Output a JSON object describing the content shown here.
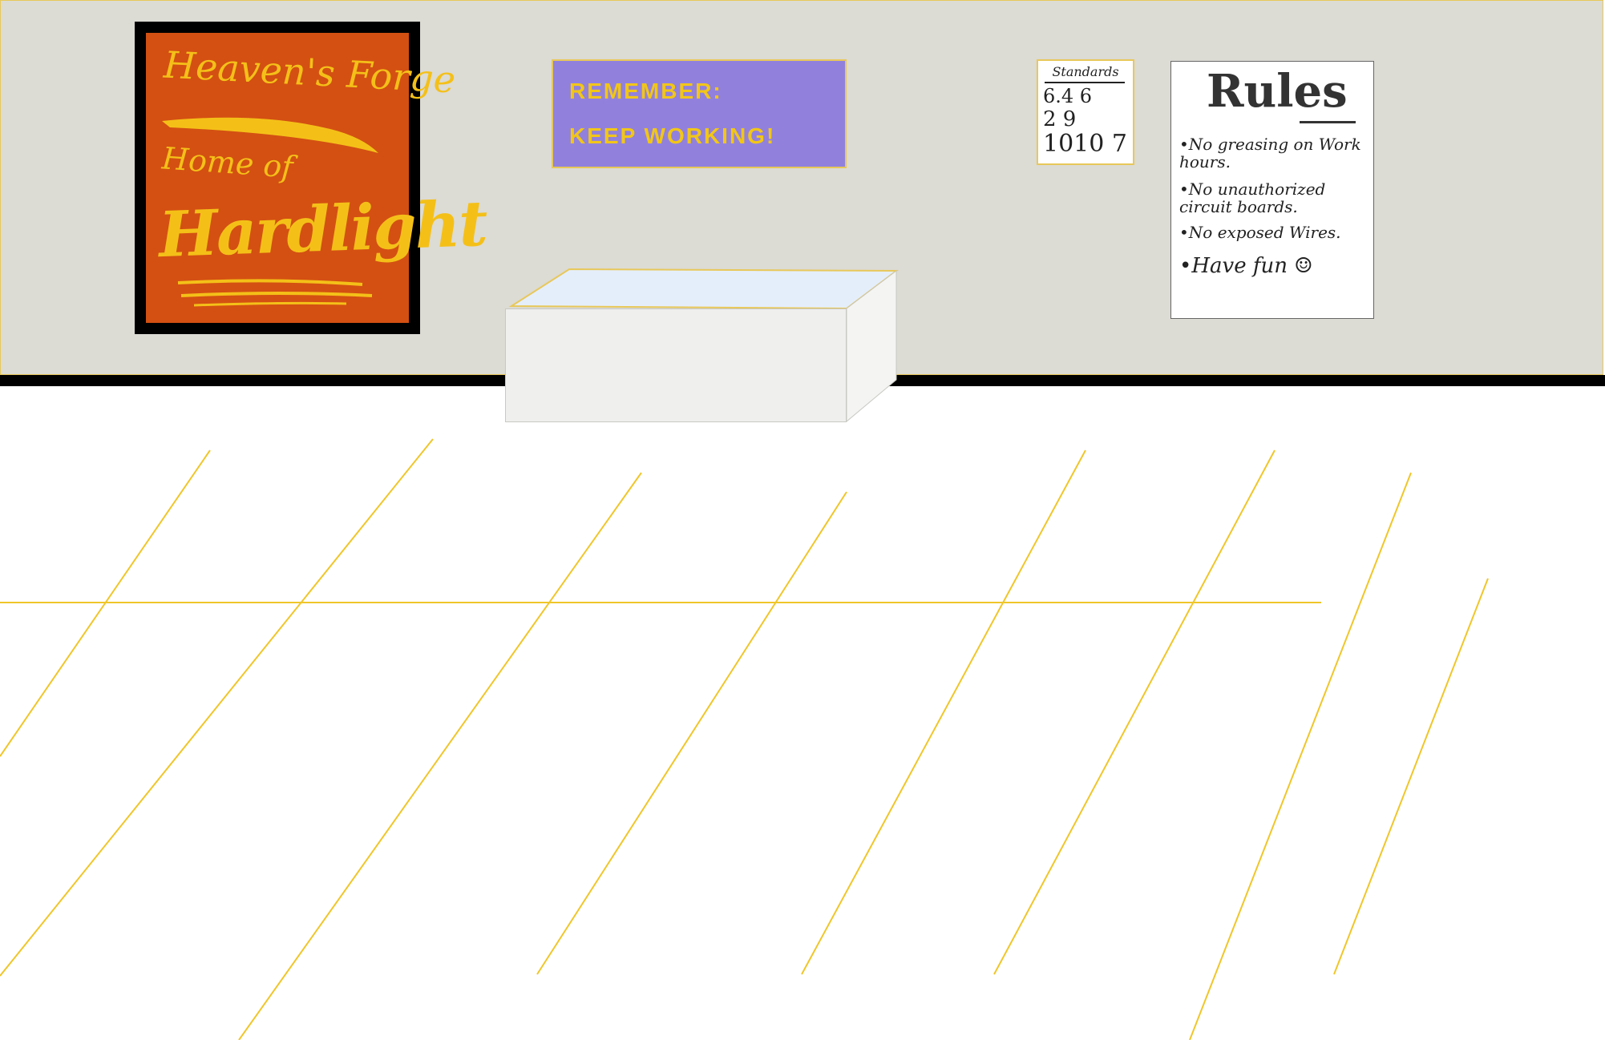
{
  "scene": {
    "colors": {
      "wall": "#dcdbd4",
      "baseboard": "#000000",
      "floor": "#ffffff",
      "floor_lines": "#f0c62a",
      "poster_bg": "#d35012",
      "poster_text": "#f4c018",
      "sign_bg": "#9181dd",
      "sign_text": "#f2c617",
      "desk_top": "#e4eefb"
    }
  },
  "forge_poster": {
    "line1": "Heaven's Forge",
    "line2": "Home of",
    "line3": "Hardlight"
  },
  "remember_sign": {
    "line1": "REMEMBER:",
    "line2": "KEEP WORKING!"
  },
  "standards": {
    "title": "Standards",
    "row1": "6.4   6",
    "row2": "2   9",
    "row3": "1010  7"
  },
  "rules": {
    "title": "Rules",
    "items": [
      "•No greasing on Work hours.",
      "•No unauthorized circuit boards.",
      "•No exposed Wires.",
      "•Have fun ☺"
    ]
  }
}
